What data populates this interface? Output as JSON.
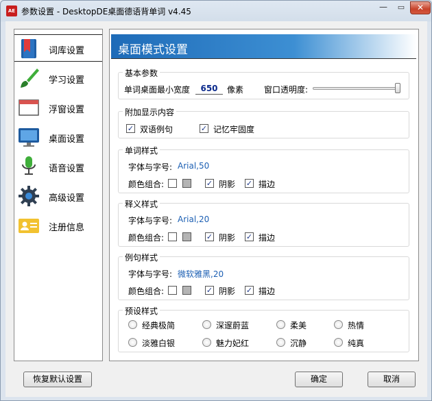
{
  "window": {
    "title": "参数设置 - DesktopDE桌面德语背单词 v4.45",
    "app_icon_text": "AE",
    "minimize_glyph": "—",
    "maximize_glyph": "▭",
    "close_glyph": "✕"
  },
  "sidebar": {
    "items": [
      {
        "label": "词库设置",
        "icon": "bookmark-book-icon",
        "selected": true
      },
      {
        "label": "学习设置",
        "icon": "paintbrush-icon"
      },
      {
        "label": "浮窗设置",
        "icon": "window-icon"
      },
      {
        "label": "桌面设置",
        "icon": "monitor-icon"
      },
      {
        "label": "语音设置",
        "icon": "microphone-icon"
      },
      {
        "label": "高级设置",
        "icon": "gear-icon"
      },
      {
        "label": "注册信息",
        "icon": "id-card-icon"
      }
    ]
  },
  "panel": {
    "title": "桌面模式设置",
    "basic": {
      "group_title": "基本参数",
      "min_width_label": "单词桌面最小宽度",
      "min_width_value": "650",
      "min_width_unit": "像素",
      "opacity_label": "窗口透明度:",
      "opacity_level": 1.0
    },
    "extra": {
      "group_title": "附加显示内容",
      "bilingual_label": "双语例句",
      "bilingual_checked": true,
      "memory_label": "记忆牢固度",
      "memory_checked": true
    },
    "word_style": {
      "group_title": "单词样式",
      "font_label": "字体与字号:",
      "font_value": "Arial,50",
      "color_label": "颜色组合:",
      "shadow_label": "阴影",
      "stroke_label": "描边"
    },
    "meaning_style": {
      "group_title": "释义样式",
      "font_label": "字体与字号:",
      "font_value": "Arial,20",
      "color_label": "颜色组合:",
      "shadow_label": "阴影",
      "stroke_label": "描边"
    },
    "example_style": {
      "group_title": "例句样式",
      "font_label": "字体与字号:",
      "font_value": "微软雅黑,20",
      "color_label": "颜色组合:",
      "shadow_label": "阴影",
      "stroke_label": "描边"
    },
    "presets": {
      "group_title": "预设样式",
      "options": [
        "经典极简",
        "深邃蔚蓝",
        "柔美",
        "热情",
        "淡雅白银",
        "魅力妃红",
        "沉静",
        "纯真"
      ]
    }
  },
  "colors": {
    "swatch_white": "#ffffff",
    "swatch_gray": "#b4b4b4",
    "accent": "#1e6bb8"
  },
  "buttons": {
    "restore_default": "恢复默认设置",
    "ok": "确定",
    "cancel": "取消"
  }
}
